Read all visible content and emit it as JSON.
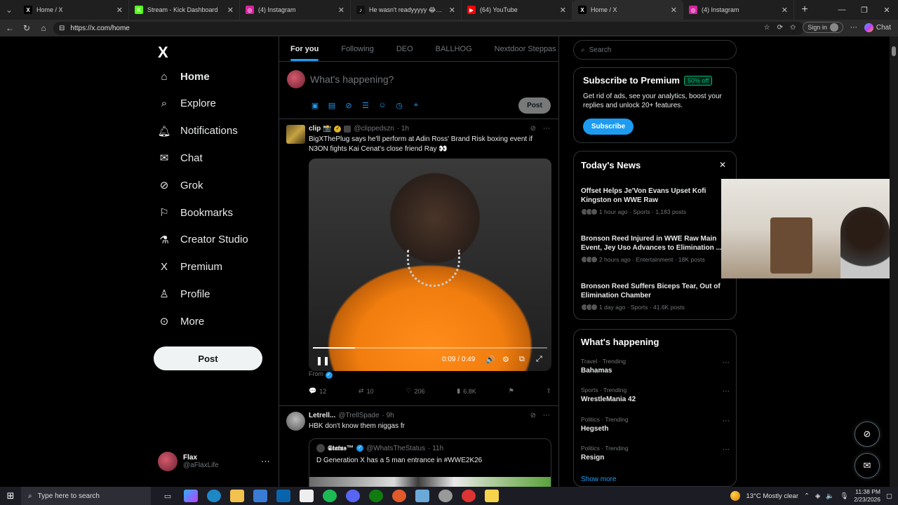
{
  "browser": {
    "tabs": [
      {
        "title": "Home / X",
        "favicon": "X",
        "color": "#000000"
      },
      {
        "title": "Stream - Kick Dashboard",
        "favicon": "K",
        "color": "#53fc18"
      },
      {
        "title": "(4) Instagram",
        "favicon": "◎",
        "color": "#d6249f"
      },
      {
        "title": "He wasn't readyyyyy 😂😂😂😂 (",
        "favicon": "♪",
        "color": "#111111"
      },
      {
        "title": "(64) YouTube",
        "favicon": "▶",
        "color": "#ff0000"
      },
      {
        "title": "Home / X",
        "favicon": "X",
        "color": "#000000",
        "active": true
      },
      {
        "title": "(4) Instagram",
        "favicon": "◎",
        "color": "#d6249f"
      }
    ],
    "url": "https://x.com/home",
    "signin_label": "Sign in",
    "chat_label": "Chat"
  },
  "nav": {
    "logo": "X",
    "items": [
      {
        "label": "Home",
        "icon": "home-icon"
      },
      {
        "label": "Explore",
        "icon": "search-icon"
      },
      {
        "label": "Notifications",
        "icon": "bell-icon"
      },
      {
        "label": "Chat",
        "icon": "mail-icon"
      },
      {
        "label": "Grok",
        "icon": "grok-icon"
      },
      {
        "label": "Bookmarks",
        "icon": "bookmark-icon"
      },
      {
        "label": "Creator Studio",
        "icon": "flask-icon"
      },
      {
        "label": "Premium",
        "icon": "x-logo-icon"
      },
      {
        "label": "Profile",
        "icon": "person-icon"
      },
      {
        "label": "More",
        "icon": "more-circle-icon"
      }
    ],
    "post_label": "Post",
    "account": {
      "name": "Flax",
      "handle": "@aFlaxLife"
    }
  },
  "feed": {
    "tabs": [
      "For you",
      "Following",
      "DEO",
      "BALLHOG",
      "Nextdoor Steppas"
    ],
    "compose_placeholder": "What's happening?",
    "post_button": "Post",
    "tweets": [
      {
        "name": "clip 📸",
        "handle": "@clippedszn",
        "time": "· 1h",
        "text": "BigXThePlug says he'll perform at Adin Ross' Brand Risk boxing event if N3ON fights Kai Cenat's close friend Ray 👀",
        "video_time": "0:09 / 0:49",
        "video_progress": 0.18,
        "from": "From",
        "replies": "12",
        "reposts": "10",
        "likes": "206",
        "views": "6.8K"
      },
      {
        "name": "Letrell...",
        "handle": "@TrellSpade",
        "time": "· 9h",
        "text": "HBK don't know them niggas fr",
        "quote": {
          "name": "𝕾𝖙𝖆𝖙𝖚𝖘™",
          "handle": "@WhatsTheStatus",
          "time": "· 11h",
          "text": "D Generation X has a 5 man entrance in #WWE2K26"
        }
      }
    ]
  },
  "sidebar": {
    "search_placeholder": "Search",
    "premium": {
      "title": "Subscribe to Premium",
      "badge": "50% off",
      "text": "Get rid of ads, see your analytics, boost your replies and unlock 20+ features.",
      "button": "Subscribe"
    },
    "news": {
      "title": "Today's News",
      "items": [
        {
          "title": "Offset Helps Je'Von Evans Upset Kofi Kingston on WWE Raw",
          "meta": "1 hour ago · Sports · 1,183 posts"
        },
        {
          "title": "Bronson Reed Injured in WWE Raw Main Event, Jey Uso Advances to Elimination ...",
          "meta": "2 hours ago · Entertainment · 18K posts"
        },
        {
          "title": "Bronson Reed Suffers Biceps Tear, Out of Elimination Chamber",
          "meta": "1 day ago · Sports · 41.6K posts"
        }
      ]
    },
    "trending": {
      "title": "What's happening",
      "items": [
        {
          "category": "Travel · Trending",
          "name": "Bahamas"
        },
        {
          "category": "Sports · Trending",
          "name": "WrestleMania 42"
        },
        {
          "category": "Politics · Trending",
          "name": "Hegseth"
        },
        {
          "category": "Politics · Trending",
          "name": "Resign"
        }
      ],
      "show_more": "Show more"
    }
  },
  "taskbar": {
    "search_placeholder": "Type here to search",
    "weather": "13°C  Mostly clear",
    "time": "11:38 PM",
    "date": "2/23/2026"
  }
}
